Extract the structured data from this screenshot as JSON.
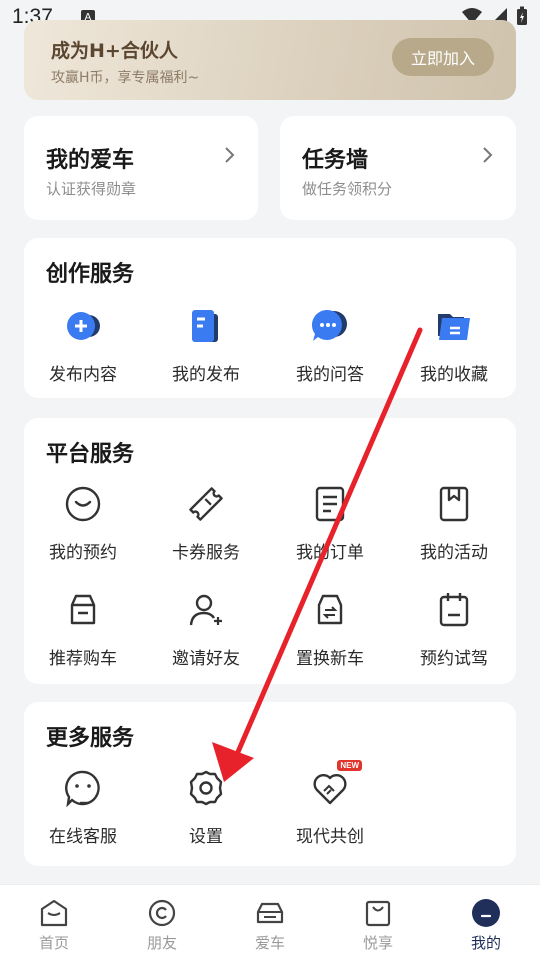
{
  "status_bar": {
    "time": "1:37",
    "notification_letter": "A"
  },
  "banner": {
    "title": "成为H+合伙人",
    "subtitle": "攻赢H币，享专属福利~",
    "button": "立即加入"
  },
  "cards": {
    "my_car": {
      "title": "我的爱车",
      "subtitle": "认证获得勋章"
    },
    "tasks": {
      "title": "任务墙",
      "subtitle": "做任务领积分"
    }
  },
  "creation": {
    "title": "创作服务",
    "items": [
      "发布内容",
      "我的发布",
      "我的问答",
      "我的收藏"
    ]
  },
  "platform": {
    "title": "平台服务",
    "items": [
      "我的预约",
      "卡券服务",
      "我的订单",
      "我的活动",
      "推荐购车",
      "邀请好友",
      "置换新车",
      "预约试驾"
    ]
  },
  "more": {
    "title": "更多服务",
    "items": [
      "在线客服",
      "设置",
      "现代共创"
    ],
    "new_badge": "NEW"
  },
  "nav": {
    "items": [
      "首页",
      "朋友",
      "爱车",
      "悦享",
      "我的"
    ],
    "active": "我的"
  },
  "colors": {
    "accent_blue": "#3a7bf2",
    "navy": "#1f2f5a",
    "annotation_red": "#e8222a",
    "banner_button": "#b8a98a"
  }
}
